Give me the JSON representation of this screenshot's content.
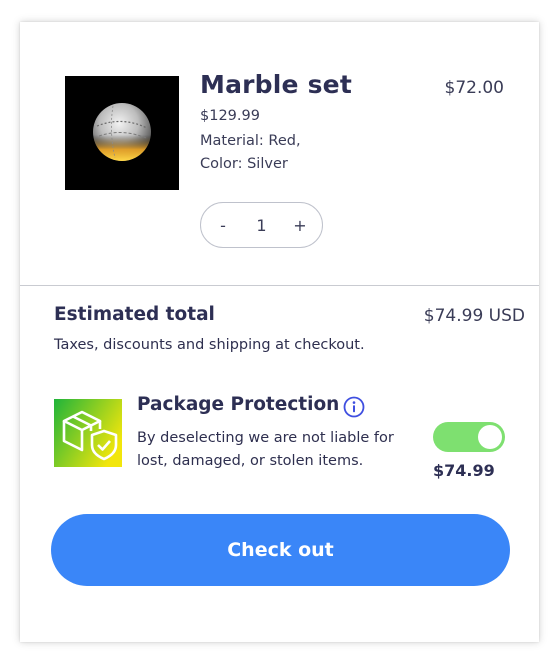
{
  "product": {
    "title": "Marble set",
    "price": "$72.00",
    "original_price": "$129.99",
    "material": "Material: Red,",
    "color": "Color: Silver",
    "image_icon": "marble-ball-image"
  },
  "quantity": {
    "decrement_label": "-",
    "value": "1",
    "increment_label": "+"
  },
  "summary": {
    "estimated_total_label": "Estimated total",
    "estimated_total_value": "$74.99 USD",
    "note": "Taxes, discounts and shipping at checkout."
  },
  "protection": {
    "title": "Package Protection",
    "description_line1": "By deselecting we are not liable for",
    "description_line2": "lost, damaged, or stolen items.",
    "price": "$74.99",
    "enabled": true,
    "icon": "package-shield-icon",
    "info_icon": "info-icon"
  },
  "checkout": {
    "label": "Check out"
  },
  "colors": {
    "accent": "#3a86f8",
    "toggle_on": "#7ee070",
    "text_primary": "#2d2f54",
    "icon_gradient_start": "#1fb43a",
    "icon_gradient_end": "#f2e60c"
  }
}
